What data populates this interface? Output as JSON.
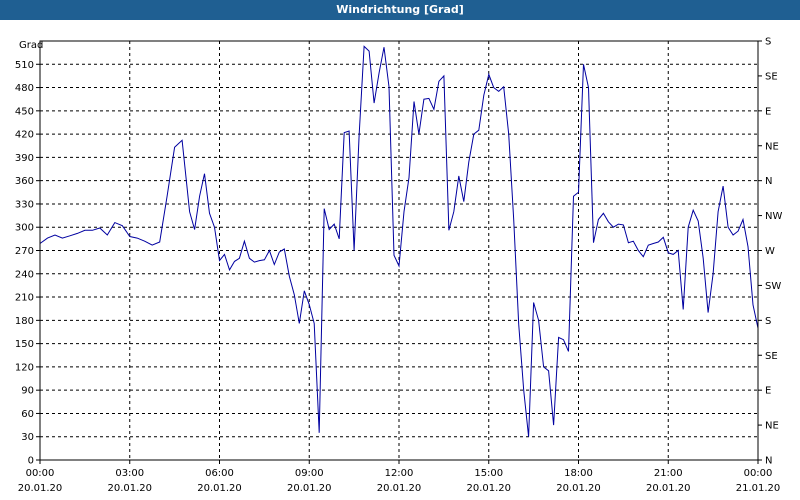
{
  "title": "Windrichtung [Grad]",
  "chart_data": {
    "type": "line",
    "title": "Windrichtung [Grad]",
    "ylabel": "Grad",
    "xlabel": "",
    "ylim": [
      0,
      540
    ],
    "xlim": [
      "20.01.20 00:00",
      "21.01.20 00:00"
    ],
    "grid": true,
    "line_color": "#0000a0",
    "y_ticks": [
      0,
      30,
      60,
      90,
      120,
      150,
      180,
      210,
      240,
      270,
      300,
      330,
      360,
      390,
      420,
      450,
      480,
      510
    ],
    "y_right_ticks": [
      "N",
      "NE",
      "E",
      "SE",
      "S",
      "SW",
      "W",
      "NW",
      "N",
      "NE",
      "E",
      "SE",
      "S"
    ],
    "x_ticks": [
      {
        "time": "00:00",
        "date": "20.01.20"
      },
      {
        "time": "03:00",
        "date": "20.01.20"
      },
      {
        "time": "06:00",
        "date": "20.01.20"
      },
      {
        "time": "09:00",
        "date": "20.01.20"
      },
      {
        "time": "12:00",
        "date": "20.01.20"
      },
      {
        "time": "15:00",
        "date": "20.01.20"
      },
      {
        "time": "18:00",
        "date": "20.01.20"
      },
      {
        "time": "21:00",
        "date": "20.01.20"
      },
      {
        "time": "00:00",
        "date": "21.01.20"
      }
    ],
    "series": [
      {
        "points": [
          [
            "20.01.20 00:00",
            279
          ],
          [
            "20.01.20 00:15",
            286
          ],
          [
            "20.01.20 00:30",
            290
          ],
          [
            "20.01.20 00:45",
            286
          ],
          [
            "20.01.20 01:00",
            289
          ],
          [
            "20.01.20 01:15",
            292
          ],
          [
            "20.01.20 01:30",
            296
          ],
          [
            "20.01.20 01:45",
            296
          ],
          [
            "20.01.20 02:00",
            299
          ],
          [
            "20.01.20 02:15",
            290
          ],
          [
            "20.01.20 02:30",
            306
          ],
          [
            "20.01.20 02:45",
            302
          ],
          [
            "20.01.20 03:00",
            288
          ],
          [
            "20.01.20 03:15",
            286
          ],
          [
            "20.01.20 03:30",
            282
          ],
          [
            "20.01.20 03:45",
            277
          ],
          [
            "20.01.20 04:00",
            281
          ],
          [
            "20.01.20 04:15",
            340
          ],
          [
            "20.01.20 04:30",
            403
          ],
          [
            "20.01.20 04:45",
            412
          ],
          [
            "20.01.20 05:00",
            320
          ],
          [
            "20.01.20 05:10",
            297
          ],
          [
            "20.01.20 05:20",
            340
          ],
          [
            "20.01.20 05:30",
            369
          ],
          [
            "20.01.20 05:40",
            318
          ],
          [
            "20.01.20 05:50",
            300
          ],
          [
            "20.01.20 06:00",
            257
          ],
          [
            "20.01.20 06:10",
            265
          ],
          [
            "20.01.20 06:20",
            245
          ],
          [
            "20.01.20 06:30",
            256
          ],
          [
            "20.01.20 06:40",
            260
          ],
          [
            "20.01.20 06:50",
            282
          ],
          [
            "20.01.20 07:00",
            260
          ],
          [
            "20.01.20 07:10",
            255
          ],
          [
            "20.01.20 07:20",
            257
          ],
          [
            "20.01.20 07:30",
            258
          ],
          [
            "20.01.20 07:40",
            270
          ],
          [
            "20.01.20 07:50",
            252
          ],
          [
            "20.01.20 08:00",
            268
          ],
          [
            "20.01.20 08:10",
            272
          ],
          [
            "20.01.20 08:20",
            237
          ],
          [
            "20.01.20 08:30",
            213
          ],
          [
            "20.01.20 08:40",
            176
          ],
          [
            "20.01.20 08:50",
            218
          ],
          [
            "20.01.20 09:00",
            200
          ],
          [
            "20.01.20 09:10",
            176
          ],
          [
            "20.01.20 09:20",
            35
          ],
          [
            "20.01.20 09:30",
            324
          ],
          [
            "20.01.20 09:40",
            297
          ],
          [
            "20.01.20 09:50",
            304
          ],
          [
            "20.01.20 10:00",
            285
          ],
          [
            "20.01.20 10:10",
            422
          ],
          [
            "20.01.20 10:20",
            424
          ],
          [
            "20.01.20 10:30",
            270
          ],
          [
            "20.01.20 10:40",
            418
          ],
          [
            "20.01.20 10:50",
            533
          ],
          [
            "20.01.20 11:00",
            527
          ],
          [
            "20.01.20 11:10",
            460
          ],
          [
            "20.01.20 11:20",
            499
          ],
          [
            "20.01.20 11:30",
            532
          ],
          [
            "20.01.20 11:40",
            481
          ],
          [
            "20.01.20 11:50",
            264
          ],
          [
            "20.01.20 12:00",
            250
          ],
          [
            "20.01.20 12:10",
            320
          ],
          [
            "20.01.20 12:20",
            364
          ],
          [
            "20.01.20 12:30",
            462
          ],
          [
            "20.01.20 12:40",
            420
          ],
          [
            "20.01.20 12:50",
            465
          ],
          [
            "20.01.20 13:00",
            466
          ],
          [
            "20.01.20 13:10",
            452
          ],
          [
            "20.01.20 13:20",
            488
          ],
          [
            "20.01.20 13:30",
            495
          ],
          [
            "20.01.20 13:40",
            296
          ],
          [
            "20.01.20 13:50",
            320
          ],
          [
            "20.01.20 14:00",
            366
          ],
          [
            "20.01.20 14:10",
            333
          ],
          [
            "20.01.20 14:20",
            384
          ],
          [
            "20.01.20 14:30",
            420
          ],
          [
            "20.01.20 14:40",
            425
          ],
          [
            "20.01.20 14:50",
            470
          ],
          [
            "20.01.20 15:00",
            497
          ],
          [
            "20.01.20 15:10",
            480
          ],
          [
            "20.01.20 15:20",
            475
          ],
          [
            "20.01.20 15:30",
            481
          ],
          [
            "20.01.20 15:40",
            420
          ],
          [
            "20.01.20 15:50",
            310
          ],
          [
            "20.01.20 16:00",
            175
          ],
          [
            "20.01.20 16:10",
            90
          ],
          [
            "20.01.20 16:20",
            30
          ],
          [
            "20.01.20 16:30",
            203
          ],
          [
            "20.01.20 16:40",
            180
          ],
          [
            "20.01.20 16:50",
            120
          ],
          [
            "20.01.20 17:00",
            115
          ],
          [
            "20.01.20 17:10",
            45
          ],
          [
            "20.01.20 17:20",
            158
          ],
          [
            "20.01.20 17:30",
            155
          ],
          [
            "20.01.20 17:40",
            140
          ],
          [
            "20.01.20 17:50",
            340
          ],
          [
            "20.01.20 18:00",
            345
          ],
          [
            "20.01.20 18:10",
            510
          ],
          [
            "20.01.20 18:20",
            480
          ],
          [
            "20.01.20 18:30",
            280
          ],
          [
            "20.01.20 18:40",
            310
          ],
          [
            "20.01.20 18:50",
            318
          ],
          [
            "20.01.20 19:00",
            307
          ],
          [
            "20.01.20 19:10",
            300
          ],
          [
            "20.01.20 19:20",
            304
          ],
          [
            "20.01.20 19:30",
            303
          ],
          [
            "20.01.20 19:40",
            280
          ],
          [
            "20.01.20 19:50",
            282
          ],
          [
            "20.01.20 20:00",
            270
          ],
          [
            "20.01.20 20:10",
            262
          ],
          [
            "20.01.20 20:20",
            277
          ],
          [
            "20.01.20 20:30",
            279
          ],
          [
            "20.01.20 20:40",
            281
          ],
          [
            "20.01.20 20:50",
            287
          ],
          [
            "20.01.20 21:00",
            267
          ],
          [
            "20.01.20 21:10",
            265
          ],
          [
            "20.01.20 21:20",
            270
          ],
          [
            "20.01.20 21:30",
            194
          ],
          [
            "20.01.20 21:40",
            300
          ],
          [
            "20.01.20 21:50",
            322
          ],
          [
            "20.01.20 22:00",
            308
          ],
          [
            "20.01.20 22:10",
            260
          ],
          [
            "20.01.20 22:20",
            190
          ],
          [
            "20.01.20 22:30",
            240
          ],
          [
            "20.01.20 22:40",
            320
          ],
          [
            "20.01.20 22:50",
            353
          ],
          [
            "20.01.20 23:00",
            300
          ],
          [
            "20.01.20 23:10",
            290
          ],
          [
            "20.01.20 23:20",
            295
          ],
          [
            "20.01.20 23:30",
            310
          ],
          [
            "20.01.20 23:40",
            275
          ],
          [
            "20.01.20 23:50",
            200
          ],
          [
            "21.01.20 00:00",
            170
          ]
        ]
      }
    ]
  }
}
